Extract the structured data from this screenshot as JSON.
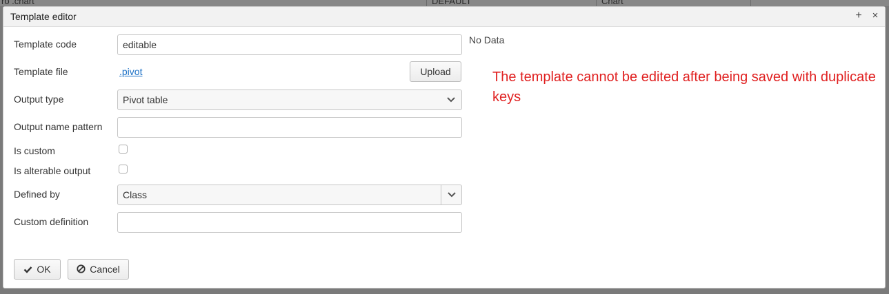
{
  "background": {
    "cells": [
      "ro .chart",
      "DEFAULT",
      "Chart"
    ]
  },
  "dialog": {
    "title": "Template editor",
    "maximize_glyph": "+",
    "close_glyph": "×"
  },
  "form": {
    "template_code": {
      "label": "Template code",
      "value": "editable"
    },
    "template_file": {
      "label": "Template file",
      "file_link": ".pivot",
      "upload_label": "Upload"
    },
    "output_type": {
      "label": "Output type",
      "value": "Pivot table"
    },
    "output_name_pattern": {
      "label": "Output name pattern",
      "value": ""
    },
    "is_custom": {
      "label": "Is custom",
      "checked": false
    },
    "is_alterable_output": {
      "label": "Is alterable output",
      "checked": false
    },
    "defined_by": {
      "label": "Defined by",
      "value": "Class"
    },
    "custom_definition": {
      "label": "Custom definition",
      "value": ""
    }
  },
  "side": {
    "no_data": "No Data",
    "annotation": "The template cannot be edited after being saved with duplicate keys",
    "annotation_color": "#e02020"
  },
  "footer": {
    "ok_label": "OK",
    "cancel_label": "Cancel"
  },
  "colors": {
    "link": "#1a6fc5",
    "overlay": "#7a7a7a"
  }
}
